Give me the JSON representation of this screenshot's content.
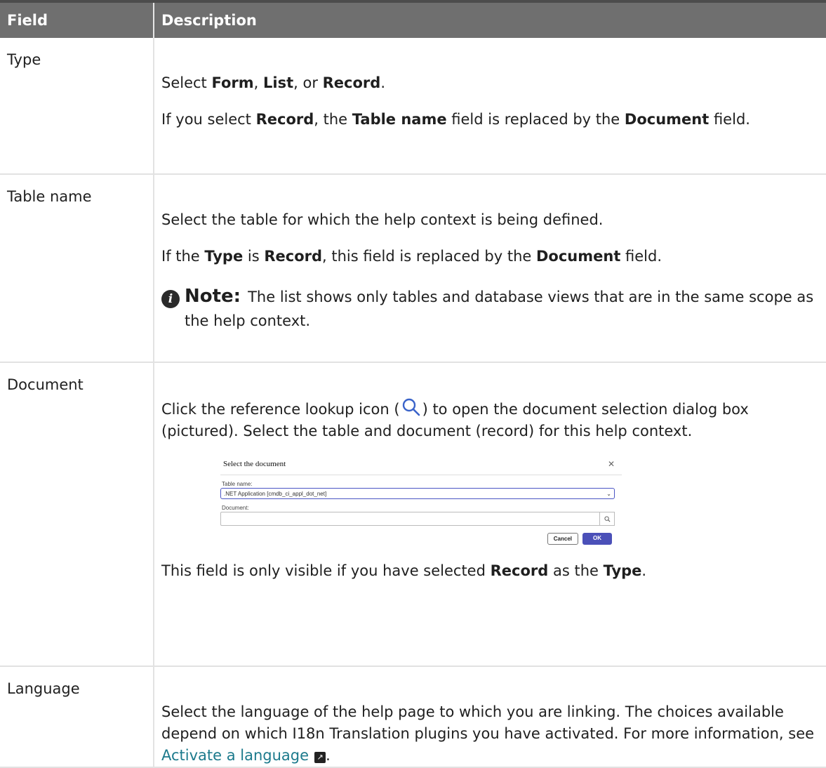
{
  "header": {
    "field": "Field",
    "description": "Description"
  },
  "rows": {
    "type": {
      "field": "Type",
      "p1": {
        "a": "Select ",
        "b": "Form",
        "c": ", ",
        "d": "List",
        "e": ", or ",
        "f": "Record",
        "g": "."
      },
      "p2": {
        "a": "If you select ",
        "b": "Record",
        "c": ", the ",
        "d": "Table name",
        "e": " field is replaced by the ",
        "f": "Document",
        "g": " field."
      }
    },
    "table_name": {
      "field": "Table name",
      "p1": "Select the table for which the help context is being defined.",
      "p2": {
        "a": "If the ",
        "b": "Type",
        "c": " is ",
        "d": "Record",
        "e": ", this field is replaced by the ",
        "f": "Document",
        "g": " field."
      },
      "note": {
        "label": "Note:",
        "text": "The list shows only tables and database views that are in the same scope as the help context."
      }
    },
    "document": {
      "field": "Document",
      "p1": {
        "a": "Click the reference lookup icon (",
        "b": ") to open the document selection dialog box (pictured). Select the table and document (record) for this help context."
      },
      "dialog": {
        "title": "Select the document",
        "table_label": "Table name:",
        "table_value": ".NET Application [cmdb_ci_appl_dot_net]",
        "document_label": "Document:",
        "document_value": "",
        "cancel": "Cancel",
        "ok": "OK"
      },
      "p2": {
        "a": "This field is only visible if you have selected ",
        "b": "Record",
        "c": " as the ",
        "d": "Type",
        "e": "."
      }
    },
    "language": {
      "field": "Language",
      "p1": "Select the language of the help page to which you are linking. The choices available depend on which I18n Translation plugins you have activated. For more information, see ",
      "link": "Activate a language",
      "p1_end": "."
    }
  },
  "icons": {
    "note": "info-icon",
    "lookup": "search-icon",
    "external_link": "external-link-icon"
  },
  "colors": {
    "header_bg": "#6f6f6f",
    "link": "#1c7a8c",
    "ok_button": "#4b50b8"
  }
}
